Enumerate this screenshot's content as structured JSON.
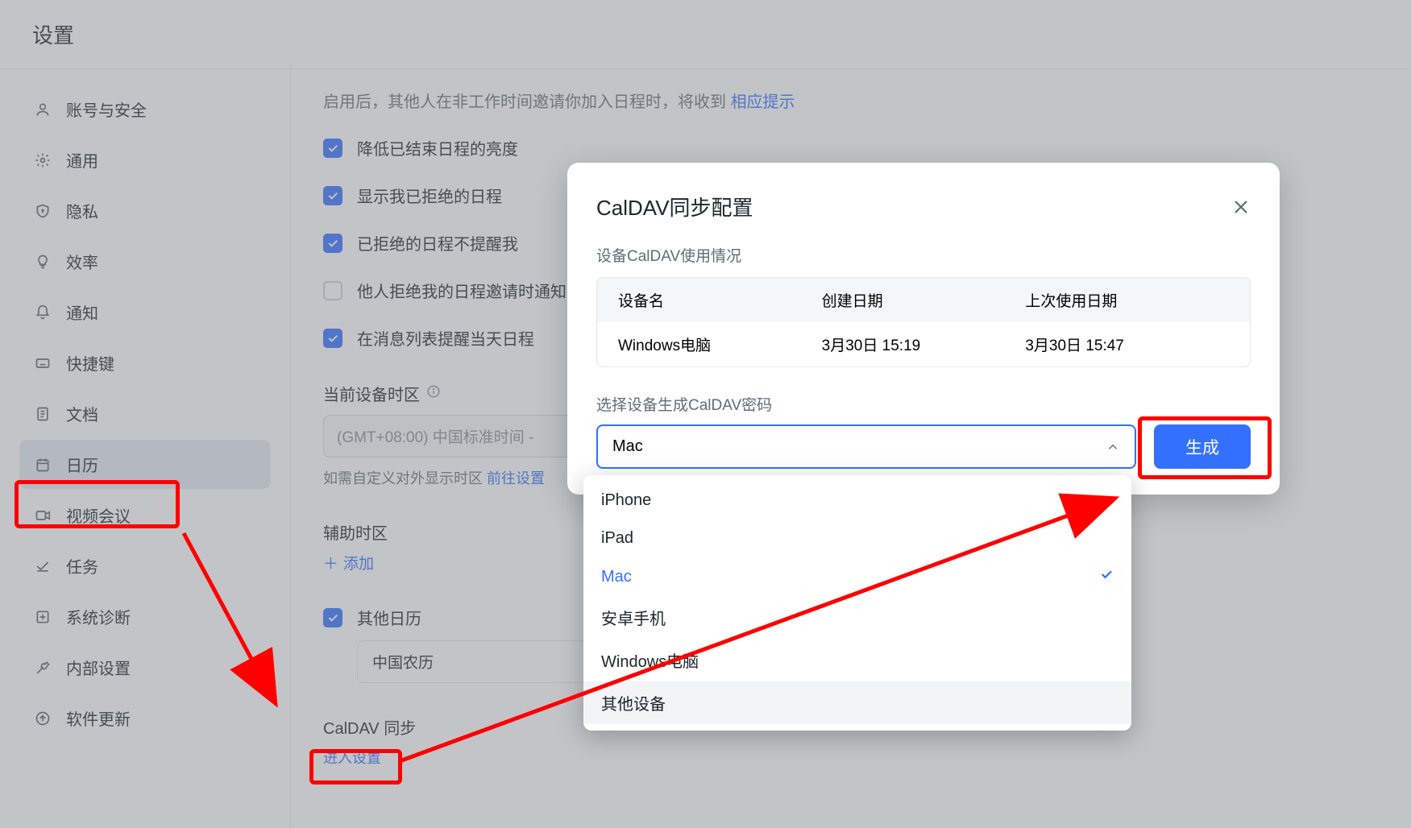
{
  "header": {
    "title": "设置"
  },
  "sidebar": {
    "items": [
      {
        "label": "账号与安全",
        "icon": "person"
      },
      {
        "label": "通用",
        "icon": "gear"
      },
      {
        "label": "隐私",
        "icon": "shield"
      },
      {
        "label": "效率",
        "icon": "bulb"
      },
      {
        "label": "通知",
        "icon": "bell"
      },
      {
        "label": "快捷键",
        "icon": "keyboard"
      },
      {
        "label": "文档",
        "icon": "doc"
      },
      {
        "label": "日历",
        "icon": "calendar",
        "active": true
      },
      {
        "label": "视频会议",
        "icon": "video"
      },
      {
        "label": "任务",
        "icon": "task"
      },
      {
        "label": "系统诊断",
        "icon": "diag"
      },
      {
        "label": "内部设置",
        "icon": "wrench"
      },
      {
        "label": "软件更新",
        "icon": "update"
      }
    ]
  },
  "main": {
    "tip_prefix": "启用后，其他人在非工作时间邀请你加入日程时，将收到 ",
    "tip_link": "相应提示",
    "checks": [
      {
        "label": "降低已结束日程的亮度",
        "checked": true
      },
      {
        "label": "显示我已拒绝的日程",
        "checked": true
      },
      {
        "label": "已拒绝的日程不提醒我",
        "checked": true
      },
      {
        "label": "他人拒绝我的日程邀请时通知",
        "checked": false
      },
      {
        "label": "在消息列表提醒当天日程",
        "checked": true
      }
    ],
    "tz_label": "当前设备时区",
    "tz_value": "(GMT+08:00) 中国标准时间 -",
    "custom_tz_prefix": "如需自定义对外显示时区 ",
    "custom_tz_link": "前往设置",
    "aux_tz_label": "辅助时区",
    "add_label": "添加",
    "other_cal_label": "其他日历",
    "other_cal_item": "中国农历",
    "caldav_label": "CalDAV 同步",
    "caldav_enter": "进入设置"
  },
  "modal": {
    "title": "CalDAV同步配置",
    "dev_caption": "设备CalDAV使用情况",
    "table": {
      "head": [
        "设备名",
        "创建日期",
        "上次使用日期"
      ],
      "rows": [
        [
          "Windows电脑",
          "3月30日 15:19",
          "3月30日 15:47"
        ]
      ]
    },
    "gen_caption": "选择设备生成CalDAV密码",
    "selected": "Mac",
    "gen_btn": "生成",
    "options": [
      "iPhone",
      "iPad",
      "Mac",
      "安卓手机",
      "Windows电脑",
      "其他设备"
    ],
    "selected_index": 2,
    "hover_index": 5
  },
  "colors": {
    "accent": "#3370ff",
    "anno": "#ff0000"
  }
}
